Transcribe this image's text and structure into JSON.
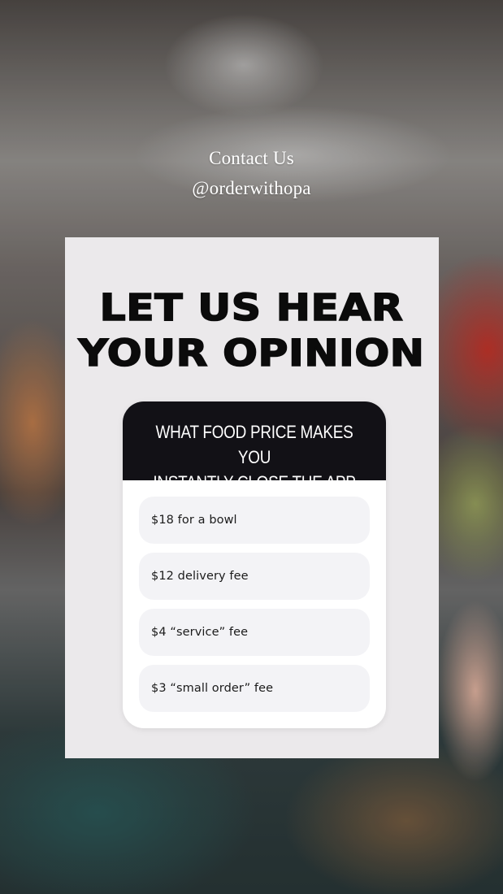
{
  "contact": {
    "title": "Contact Us",
    "handle": "@orderwithopa"
  },
  "headline": {
    "line1": "LET US HEAR",
    "line2": "YOUR OPINION"
  },
  "poll": {
    "question_line1": "WHAT FOOD PRICE MAKES YOU",
    "question_line2": "INSTANTLY CLOSE THE APP",
    "options": [
      {
        "label": "$18 for a bowl"
      },
      {
        "label": "$12 delivery fee"
      },
      {
        "label": "$4 “service” fee"
      },
      {
        "label": "$3 “small order” fee"
      }
    ]
  },
  "colors": {
    "card_background": "#ebe9eb",
    "poll_header": "#121116",
    "option_background": "#f3f3f6",
    "headline_text": "#0b0b0b"
  }
}
